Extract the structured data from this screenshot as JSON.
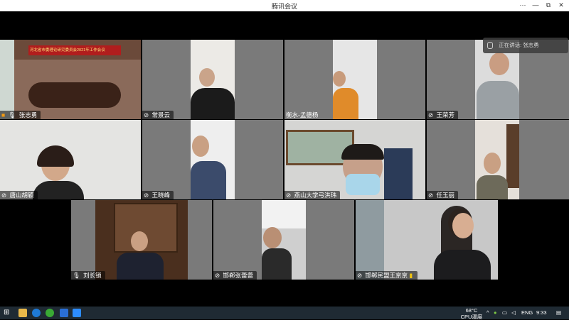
{
  "window": {
    "title": "腾讯会议",
    "buttons": {
      "more": "···",
      "minimize": "—",
      "restore": "⧉",
      "close": "✕"
    }
  },
  "speaking_banner": {
    "label": "正在讲话:",
    "name": "张志勇"
  },
  "banner_text": "河北省市委理论研究委员会2021年工作会议",
  "participants": [
    {
      "name": "张志勇"
    },
    {
      "name": "常景云"
    },
    {
      "name": "衡水-孟德杨"
    },
    {
      "name": "王荣芳"
    },
    {
      "name": "唐山胡颖"
    },
    {
      "name": "王晓峰"
    },
    {
      "name": "燕山大学弓洪玮"
    },
    {
      "name": "任玉丽"
    },
    {
      "name": "刘长锁"
    },
    {
      "name": "邯郸张蕾蕾"
    },
    {
      "name": "邯郸民盟王京京"
    }
  ],
  "taskbar": {
    "weather_temp": "68°C",
    "weather_label": "CPU温度",
    "lang": "ENG",
    "time": "9:33"
  }
}
